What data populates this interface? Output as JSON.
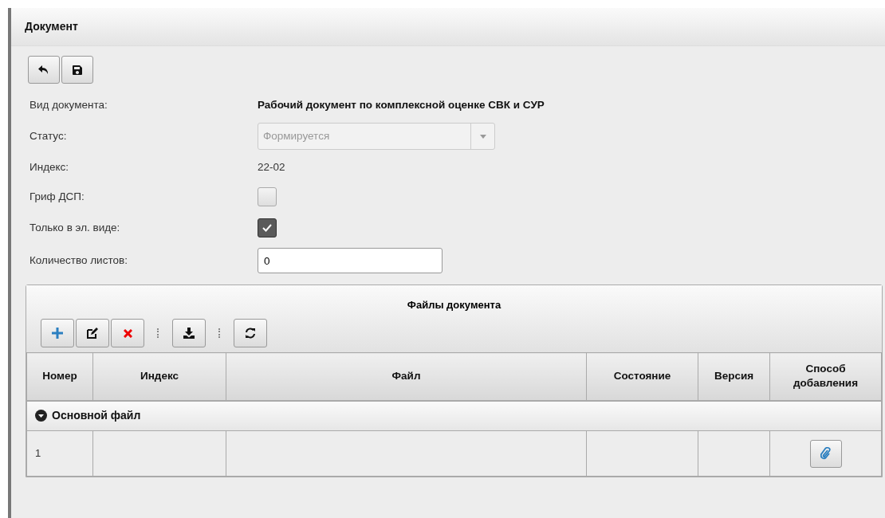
{
  "window": {
    "title": "Документ"
  },
  "toolbar": [
    {
      "kind": "undo"
    },
    {
      "kind": "save"
    }
  ],
  "fields": [
    {
      "kind": "title",
      "label": "Вид документа:",
      "value": "Рабочий документ по комплексной оценке СВК и СУР"
    },
    {
      "kind": "select",
      "label": "Статус:",
      "value": "Формируется",
      "disabled": true
    },
    {
      "kind": "text",
      "label": "Индекс:",
      "value": "22-02"
    },
    {
      "kind": "checkbox",
      "label": "Гриф ДСП:",
      "checked": false
    },
    {
      "kind": "checkbox",
      "label": "Только в эл. виде:",
      "checked": true
    },
    {
      "kind": "input",
      "label": "Количество листов:",
      "value": "0"
    }
  ],
  "files_panel": {
    "title": "Файлы документа",
    "toolbar": [
      {
        "kind": "add"
      },
      {
        "kind": "edit"
      },
      {
        "kind": "delete"
      },
      {
        "kind": "separator"
      },
      {
        "kind": "download"
      },
      {
        "kind": "separator"
      },
      {
        "kind": "refresh"
      }
    ],
    "columns": [
      "Номер",
      "Индекс",
      "Файл",
      "Состояние",
      "Версия",
      "Способ добавления"
    ],
    "groups": [
      {
        "title": "Основной файл",
        "expanded": true,
        "rows": [
          {
            "cells": [
              "1",
              "",
              "",
              "",
              ""
            ],
            "attach_button": true
          }
        ]
      }
    ]
  }
}
